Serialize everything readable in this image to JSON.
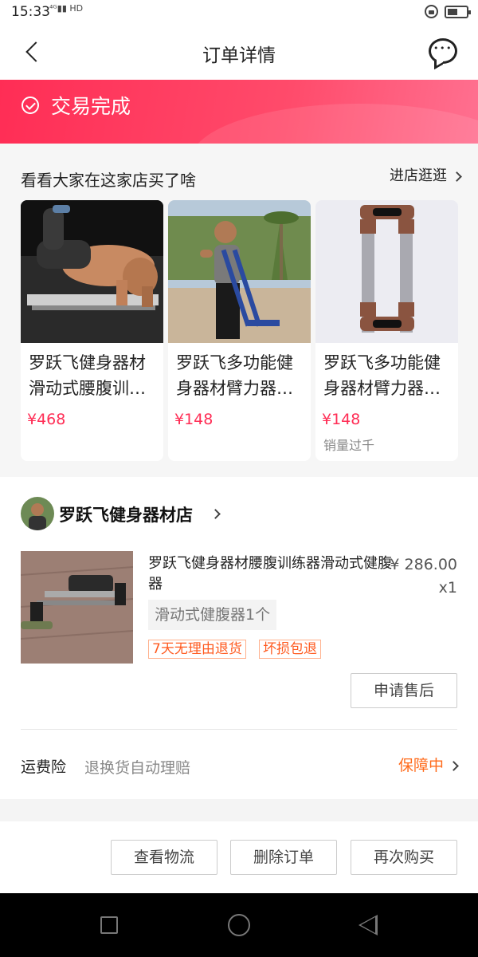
{
  "status_bar": {
    "time": "15:33",
    "signal": "⁴ᴳ▮▮ HD"
  },
  "nav": {
    "title": "订单详情",
    "back_icon": "back-chevron-icon",
    "message_icon": "chat-bubble-icon"
  },
  "order_status": {
    "text": "交易完成",
    "icon": "check-circle-icon",
    "color": "#ff2d55"
  },
  "recommendations": {
    "title": "看看大家在这家店买了啥",
    "more_label": "进店逛逛",
    "items": [
      {
        "title": "罗跃飞健身器材滑动式腰腹训…",
        "price": "¥468",
        "sales": ""
      },
      {
        "title": "罗跃飞多功能健身器材臂力器…",
        "price": "¥148",
        "sales": ""
      },
      {
        "title": "罗跃飞多功能健身器材臂力器…",
        "price": "¥148",
        "sales": "销量过千"
      }
    ]
  },
  "store": {
    "name": "罗跃飞健身器材店"
  },
  "product": {
    "title": "罗跃飞健身器材腰腹训练器滑动式健腹器",
    "price": "¥ 286.00",
    "quantity": "x1",
    "variant": "滑动式健腹器1个",
    "tags": [
      "7天无理由退货",
      "坏损包退"
    ],
    "after_sale_label": "申请售后"
  },
  "shipping_insurance": {
    "label": "运费险",
    "description": "退换货自动理赔",
    "status": "保障中"
  },
  "actions": {
    "logistics": "查看物流",
    "delete": "删除订单",
    "rebuy": "再次购买"
  },
  "colors": {
    "accent": "#ff2d55",
    "tag_orange": "#ff5a1f"
  }
}
